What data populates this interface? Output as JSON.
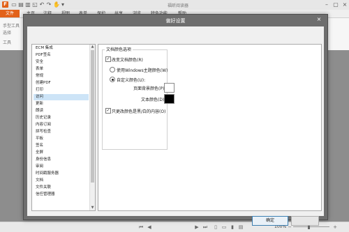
{
  "app": {
    "logo": "F",
    "title": "福昕阅读器"
  },
  "menu": {
    "file": "文件",
    "items": [
      "主页",
      "注释",
      "视图",
      "表单",
      "保护",
      "共享",
      "浏览",
      "特色功能",
      "帮助"
    ]
  },
  "ribbon": {
    "items": [
      "手型工具",
      "选择",
      "工具"
    ]
  },
  "dialog": {
    "title": "偏好设置",
    "close_icon": "×",
    "categories": [
      "ECM 集成",
      "PDF签名",
      "安全",
      "表单",
      "常规",
      "创建PDF",
      "打印",
      "访问",
      "更新",
      "朗读",
      "历史记录",
      "内容订阅",
      "拼写检查",
      "平板",
      "签名",
      "全屏",
      "身份信息",
      "审阅",
      "时间戳服务器",
      "文档",
      "文件关联",
      "信任管理器"
    ],
    "selected_category": "访问",
    "group_title": "文档颜色选项",
    "replace_colors": {
      "label": "改变文档颜色(R)",
      "checked": true
    },
    "use_windows": {
      "label": "使用Windows主题颜色(W)",
      "selected": false
    },
    "custom_color": {
      "label": "自定义颜色(U):",
      "selected": true
    },
    "page_bg": {
      "label": "页面背景颜色(P):",
      "color": "#ffffff"
    },
    "text_color": {
      "label": "文本颜色(D):",
      "color": "#000000"
    },
    "only_bw": {
      "label": "只更改颜色是黑/白的内容(O)",
      "checked": true
    },
    "ok": "确定",
    "cancel": ""
  },
  "statusbar": {
    "zoom": "100%"
  }
}
